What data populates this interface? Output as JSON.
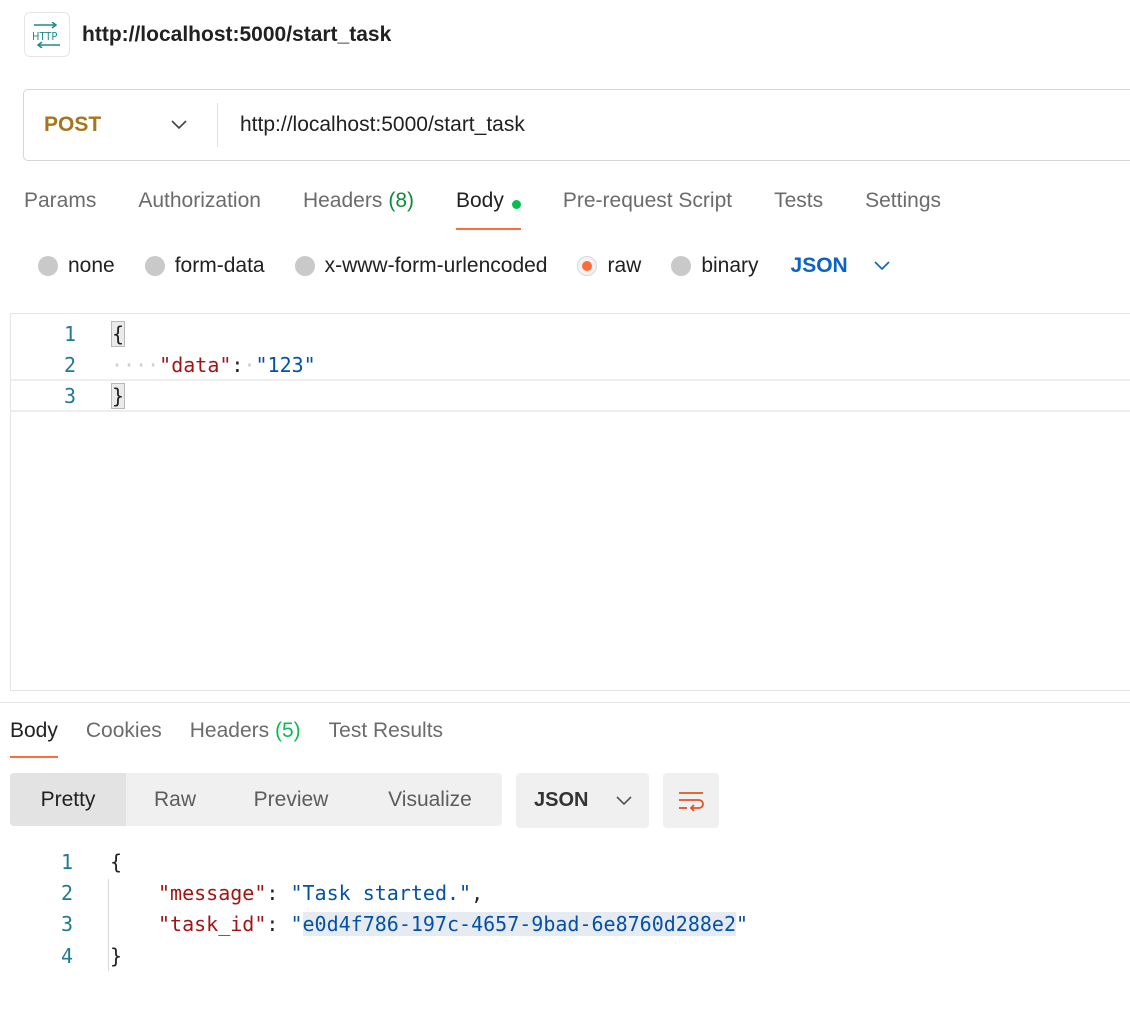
{
  "header": {
    "icon": "http-icon",
    "icon_text": "HTTP",
    "title": "http://localhost:5000/start_task"
  },
  "url_bar": {
    "method": "POST",
    "url": "http://localhost:5000/start_task"
  },
  "request_tabs": {
    "params": "Params",
    "authorization": "Authorization",
    "headers": "Headers",
    "headers_count": "(8)",
    "body": "Body",
    "pre_request": "Pre-request Script",
    "tests": "Tests",
    "settings": "Settings"
  },
  "body_types": {
    "none": "none",
    "form_data": "form-data",
    "urlencoded": "x-www-form-urlencoded",
    "raw": "raw",
    "binary": "binary",
    "language": "JSON",
    "selected": "raw"
  },
  "request_body": {
    "lines": [
      {
        "no": "1",
        "open": "{"
      },
      {
        "no": "2",
        "dots": "····",
        "key": "\"data\"",
        "colon": ":",
        "value": "\"123\""
      },
      {
        "no": "3",
        "close": "}"
      }
    ]
  },
  "response_tabs": {
    "body": "Body",
    "cookies": "Cookies",
    "headers": "Headers",
    "headers_count": "(5)",
    "test_results": "Test Results"
  },
  "response_toolbar": {
    "pretty": "Pretty",
    "raw": "Raw",
    "preview": "Preview",
    "visualize": "Visualize",
    "format": "JSON"
  },
  "response_body": {
    "l1": {
      "no": "1",
      "text": "{"
    },
    "l2": {
      "no": "2",
      "key": "\"message\"",
      "value": "\"Task started.\""
    },
    "l3": {
      "no": "3",
      "key": "\"task_id\"",
      "value_open": "\"",
      "value": "e0d4f786-197c-4657-9bad-6e8760d288e2",
      "value_close": "\""
    },
    "l4": {
      "no": "4",
      "text": "}"
    }
  },
  "colors": {
    "accent": "#ff6c37",
    "method": "#a6761d",
    "link": "#0b63c8",
    "success": "#0cbb52"
  }
}
